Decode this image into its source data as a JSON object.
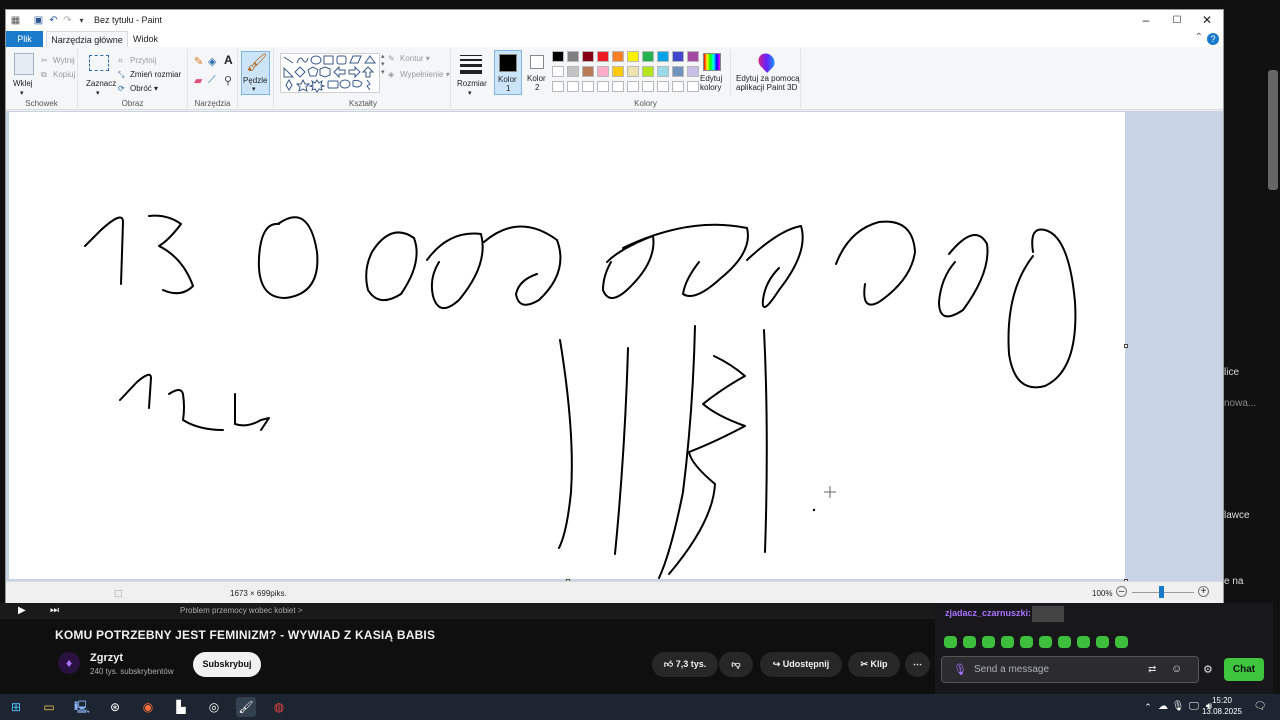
{
  "paint": {
    "title": "Bez tytułu - Paint",
    "tabs": {
      "file": "Plik",
      "home": "Narzędzia główne",
      "view": "Widok"
    },
    "clipboard": {
      "paste": "Wklej",
      "cut": "Wytnij",
      "copy": "Kopiuj",
      "label": "Schowek"
    },
    "image": {
      "select": "Zaznacz",
      "crop": "Przytnij",
      "resize": "Zmień rozmiar",
      "rotate": "Obróć",
      "label": "Obraz"
    },
    "tools": {
      "label": "Narzędzia"
    },
    "brushes": {
      "label": "Pędzle"
    },
    "shapes": {
      "outline": "Kontur",
      "fill": "Wypełnienie",
      "label": "Kształty"
    },
    "size_label": "Rozmiar",
    "color1": {
      "label1": "Kolor",
      "label2": "1"
    },
    "color2": {
      "label1": "Kolor",
      "label2": "2"
    },
    "colors_label": "Kolory",
    "edit_colors": {
      "line1": "Edytuj",
      "line2": "kolory"
    },
    "paint3d": {
      "line1": "Edytuj za pomocą",
      "line2": "aplikacji Paint 3D"
    },
    "status": {
      "dimensions": "1673 × 699piks.",
      "zoom": "100%"
    },
    "palette_row1": [
      "#000000",
      "#7f7f7f",
      "#880015",
      "#ed1c24",
      "#ff7f27",
      "#fff200",
      "#22b14c",
      "#00a2e8",
      "#3f48cc",
      "#a349a4"
    ],
    "palette_row2": [
      "#ffffff",
      "#c3c3c3",
      "#b97a57",
      "#ffaec9",
      "#ffc90e",
      "#efe4b0",
      "#b5e61d",
      "#99d9ea",
      "#7092be",
      "#c8bfe7"
    ]
  },
  "video": {
    "title": "KOMU POTRZEBNY JEST FEMINIZM? - WYWIAD Z KASIĄ BABIS",
    "channel": "Zgrzyt",
    "subscribers": "240 tys. subskrybentów",
    "subscribe": "Subskrybuj",
    "likes": "7,3 tys.",
    "share": "Udostępnij",
    "clip": "Klip",
    "strip_text": "Problem przemocy wobec kobiet >"
  },
  "chat": {
    "username": "zjadacz_czarnuszki:",
    "placeholder": "Send a message",
    "button": "Chat"
  },
  "background": {
    "items": [
      "lice",
      "nowa...",
      "lawce",
      "e na"
    ]
  },
  "taskbar": {
    "time": "15:20",
    "date": "13.08.2025"
  }
}
